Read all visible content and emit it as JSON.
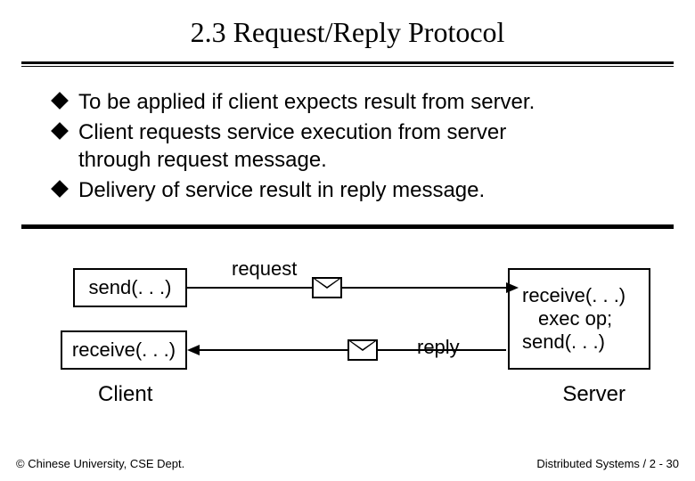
{
  "title": "2.3 Request/Reply Protocol",
  "bullets": {
    "b1": "To be applied if client expects result from server.",
    "b2a": "Client requests service execution from server",
    "b2b": "through request message.",
    "b3": "Delivery of service result in reply message."
  },
  "diagram": {
    "client_send": "send(. . .)",
    "client_receive": "receive(. . .)",
    "server_receive": "receive(. . .)",
    "server_exec": "exec op;",
    "server_send": "send(. . .)",
    "label_request": "request",
    "label_reply": "reply",
    "role_client": "Client",
    "role_server": "Server"
  },
  "footer": {
    "left": "© Chinese University, CSE Dept.",
    "right": "Distributed Systems / 2 - 30"
  }
}
